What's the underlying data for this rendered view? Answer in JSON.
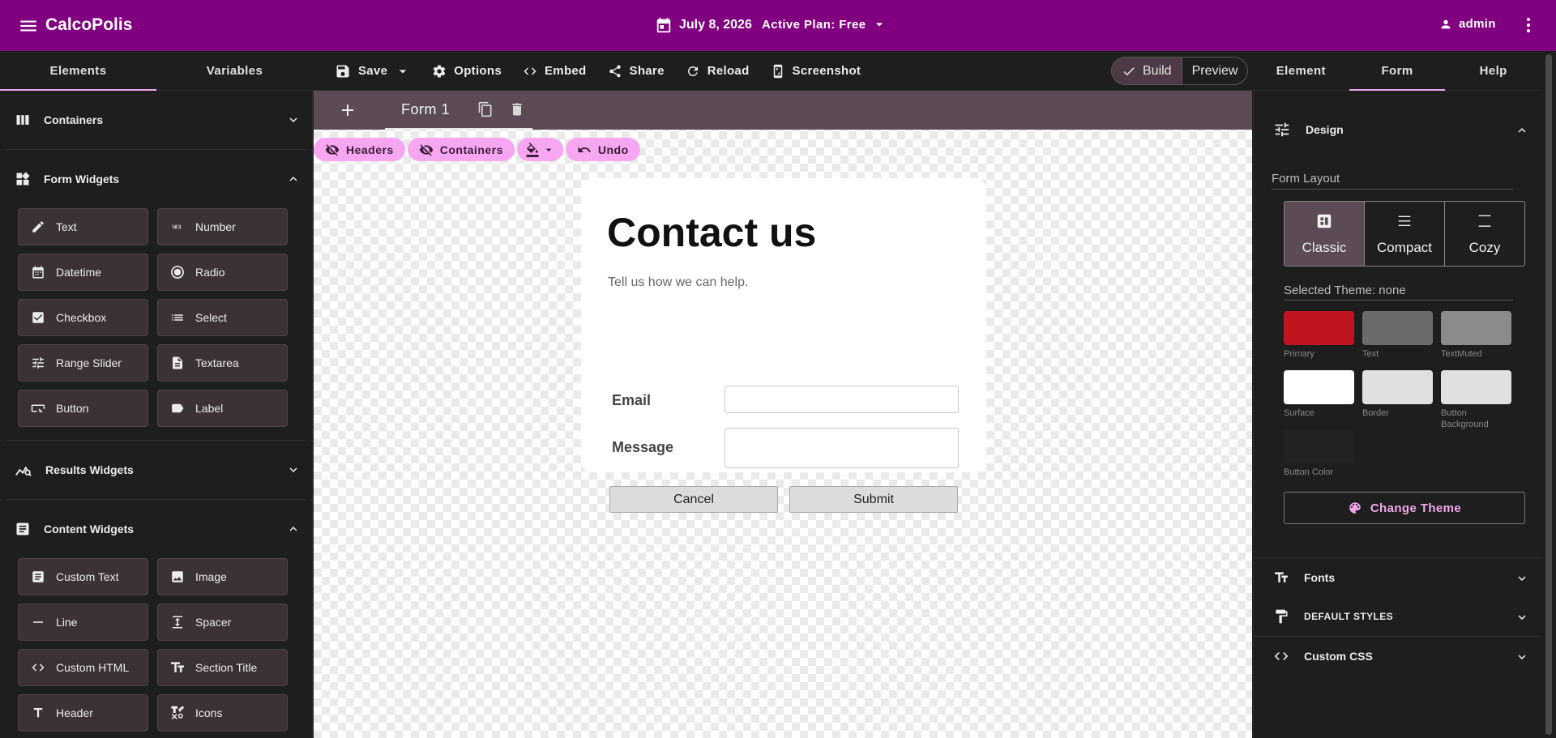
{
  "app": {
    "title": "CalcoPolis",
    "date": "July 8, 2026",
    "plan": "Active Plan: Free",
    "user": "admin"
  },
  "left_tabs": [
    "Elements",
    "Variables"
  ],
  "toolbar": {
    "save": "Save",
    "options": "Options",
    "embed": "Embed",
    "share": "Share",
    "reload": "Reload",
    "screenshot": "Screenshot"
  },
  "mode_toggle": {
    "build": "Build",
    "preview": "Preview",
    "selected": "Build"
  },
  "right_tabs": [
    "Element",
    "Form",
    "Help"
  ],
  "sidebar": {
    "containers": "Containers",
    "form_widgets": {
      "title": "Form Widgets",
      "items": [
        "Text",
        "Number",
        "Datetime",
        "Radio",
        "Checkbox",
        "Select",
        "Range Slider",
        "Textarea",
        "Button",
        "Label"
      ]
    },
    "results_widgets": "Results Widgets",
    "content_widgets": {
      "title": "Content Widgets",
      "items": [
        "Custom Text",
        "Image",
        "Line",
        "Spacer",
        "Custom HTML",
        "Section Title",
        "Header",
        "Icons"
      ]
    }
  },
  "canvas": {
    "form_tab": "Form 1",
    "chips": {
      "headers": "Headers",
      "containers": "Containers",
      "undo": "Undo"
    },
    "form": {
      "title": "Contact us",
      "subtitle": "Tell us how we can help.",
      "email_label": "Email",
      "message_label": "Message",
      "cancel": "Cancel",
      "submit": "Submit"
    }
  },
  "right_panel": {
    "design": "Design",
    "form_layout_label": "Form Layout",
    "layouts": [
      "Classic",
      "Compact",
      "Cozy"
    ],
    "selected_layout": "Classic",
    "selected_theme": "Selected Theme: none",
    "swatches": [
      {
        "name": "Primary",
        "color": "#c0141f"
      },
      {
        "name": "Text",
        "color": "#6b6b6b"
      },
      {
        "name": "TextMuted",
        "color": "#8b8b8b"
      },
      {
        "name": "Surface",
        "color": "#ffffff"
      },
      {
        "name": "Border",
        "color": "#e0e0e0"
      },
      {
        "name": "Button Background",
        "color": "#e0e0e0"
      },
      {
        "name": "Button Color",
        "color": "#222222"
      }
    ],
    "change_theme": "Change Theme",
    "fonts": "Fonts",
    "default_styles": "DEFAULT STYLES",
    "custom_css": "Custom CSS"
  },
  "colors": {
    "brand": "#800080",
    "accent": "#f2a7ec",
    "chip": "#f7a6f2"
  }
}
